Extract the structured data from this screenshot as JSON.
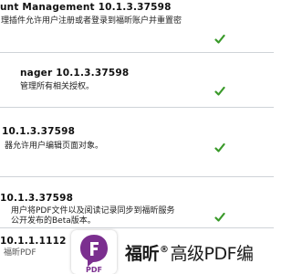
{
  "plugins": [
    {
      "title": "unt Management  10.1.3.37598",
      "description_lines": [
        "理插件允许用户注册或者登录到福昕账户并重置密"
      ],
      "enabled": true
    },
    {
      "title": "nager  10.1.3.37598",
      "description_lines": [
        "管理所有相关授权。"
      ],
      "enabled": true
    },
    {
      "title": "  10.1.3.37598",
      "description_lines": [
        "器允许用户编辑页面对象。"
      ],
      "enabled": true
    },
    {
      "title": "  10.1.3.37598",
      "description_lines": [
        "用户将PDF文件以及阅读记录同步到福昕服务",
        "公开发布的Beta版本。"
      ],
      "enabled": true
    },
    {
      "title": "  10.1.1.1112",
      "description_lines": [
        "福昕PDF"
      ],
      "enabled": null
    }
  ],
  "banner": {
    "brand_name": "福昕",
    "registered_mark": "®",
    "product_name": "高级PDF编",
    "logo_text": "PDF",
    "logo_icon": "foxit-logo-icon"
  },
  "colors": {
    "check": "#3a9a2a",
    "logo_purple": "#7b2f8f",
    "row_border": "#cfd3d8"
  }
}
